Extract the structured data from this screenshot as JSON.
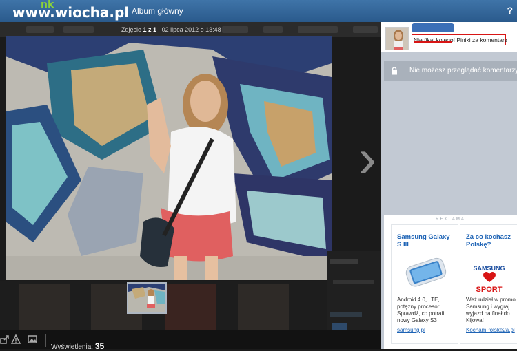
{
  "header": {
    "logo_text": "www.wiocha.pl",
    "logo_prefix": "nk",
    "album_title": "Album główny",
    "help_label": "?"
  },
  "photo": {
    "counter_label": "Zdjęcie",
    "counter_value": "1 z 1",
    "date": "02 lipca 2012 o 13:48"
  },
  "sidebar": {
    "caption": "Nie fikaj kolego! Piniki za komentarz",
    "no_comments_text": "Nie możesz przeglądać komentarzy"
  },
  "ads": {
    "label": "REKLAMA",
    "items": [
      {
        "title": "Samsung Galaxy S III",
        "text": "Android 4.0, LTE, potężny procesor Sprawdź, co potrafi nowy Galaxy S3",
        "link": "samsung.pl"
      },
      {
        "title": "Za co kochasz Polskę?",
        "brand": "SAMSUNG",
        "brand_sub": "SPORT",
        "text": "Weź udział w promo Samsung i wygraj wyjazd na finał do Kijowa!",
        "link": "KochamPolske2a.pl"
      }
    ]
  },
  "footer": {
    "views_label": "Wyświetlenia:",
    "views_count": "35"
  },
  "colors": {
    "header_bg": "#2f6399",
    "logo_accent": "#8ad13b",
    "link_blue": "#1d63b5",
    "highlight_red": "#d81515",
    "panel_bg": "#c2c9d3"
  }
}
